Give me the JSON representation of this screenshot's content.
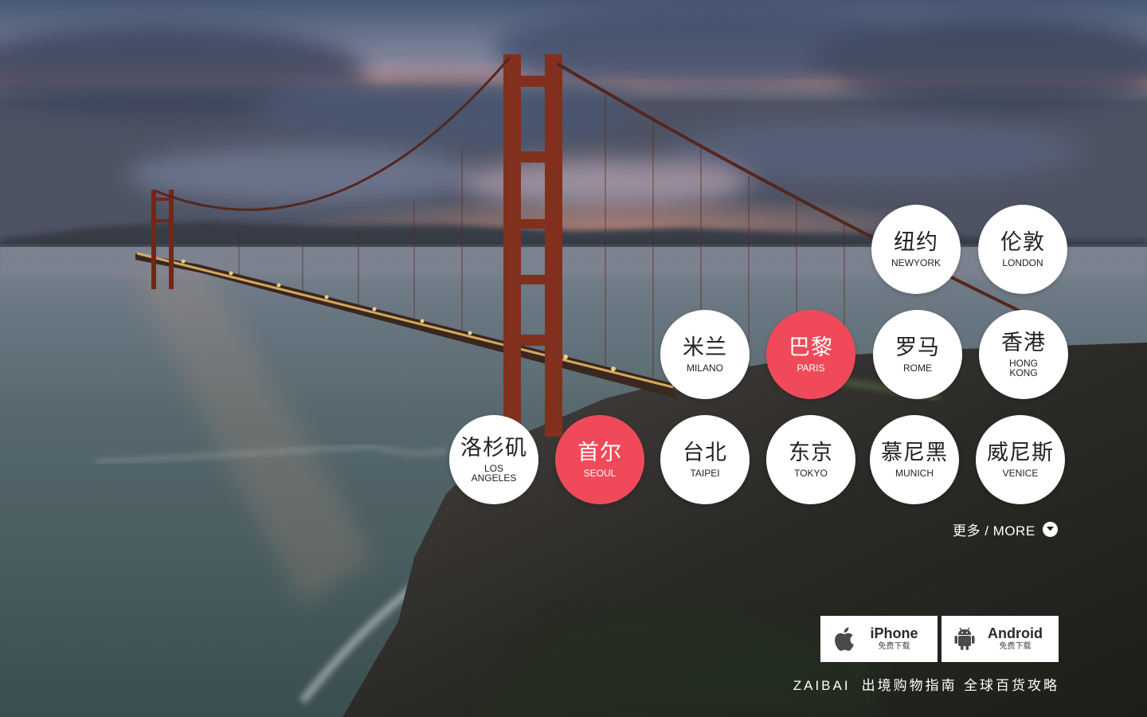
{
  "cities": [
    {
      "cn": "纽约",
      "en": "NEWYORK",
      "active": false
    },
    {
      "cn": "伦敦",
      "en": "LONDON",
      "active": false
    },
    {
      "cn": "米兰",
      "en": "MILANO",
      "active": false
    },
    {
      "cn": "巴黎",
      "en": "PARIS",
      "active": true
    },
    {
      "cn": "罗马",
      "en": "ROME",
      "active": false
    },
    {
      "cn": "香港",
      "en": "HONG\nKONG",
      "active": false
    },
    {
      "cn": "洛杉矶",
      "en": "LOS\nANGELES",
      "active": false
    },
    {
      "cn": "首尔",
      "en": "SEOUL",
      "active": true
    },
    {
      "cn": "台北",
      "en": "TAIPEI",
      "active": false
    },
    {
      "cn": "东京",
      "en": "TOKYO",
      "active": false
    },
    {
      "cn": "慕尼黑",
      "en": "MUNICH",
      "active": false
    },
    {
      "cn": "威尼斯",
      "en": "VENICE",
      "active": false
    }
  ],
  "more": {
    "label": "更多 / MORE",
    "icon": "chevron-down-icon"
  },
  "downloads": {
    "iphone": {
      "name": "iPhone",
      "sub": "免费下载",
      "icon": "apple-icon"
    },
    "android": {
      "name": "Android",
      "sub": "免费下载",
      "icon": "android-icon"
    }
  },
  "footer": {
    "brand": "ZAIBAI",
    "tagline": "出境购物指南 全球百货攻略"
  },
  "colors": {
    "accent": "#f04a5a",
    "bubble": "#ffffff",
    "text": "#222222"
  }
}
